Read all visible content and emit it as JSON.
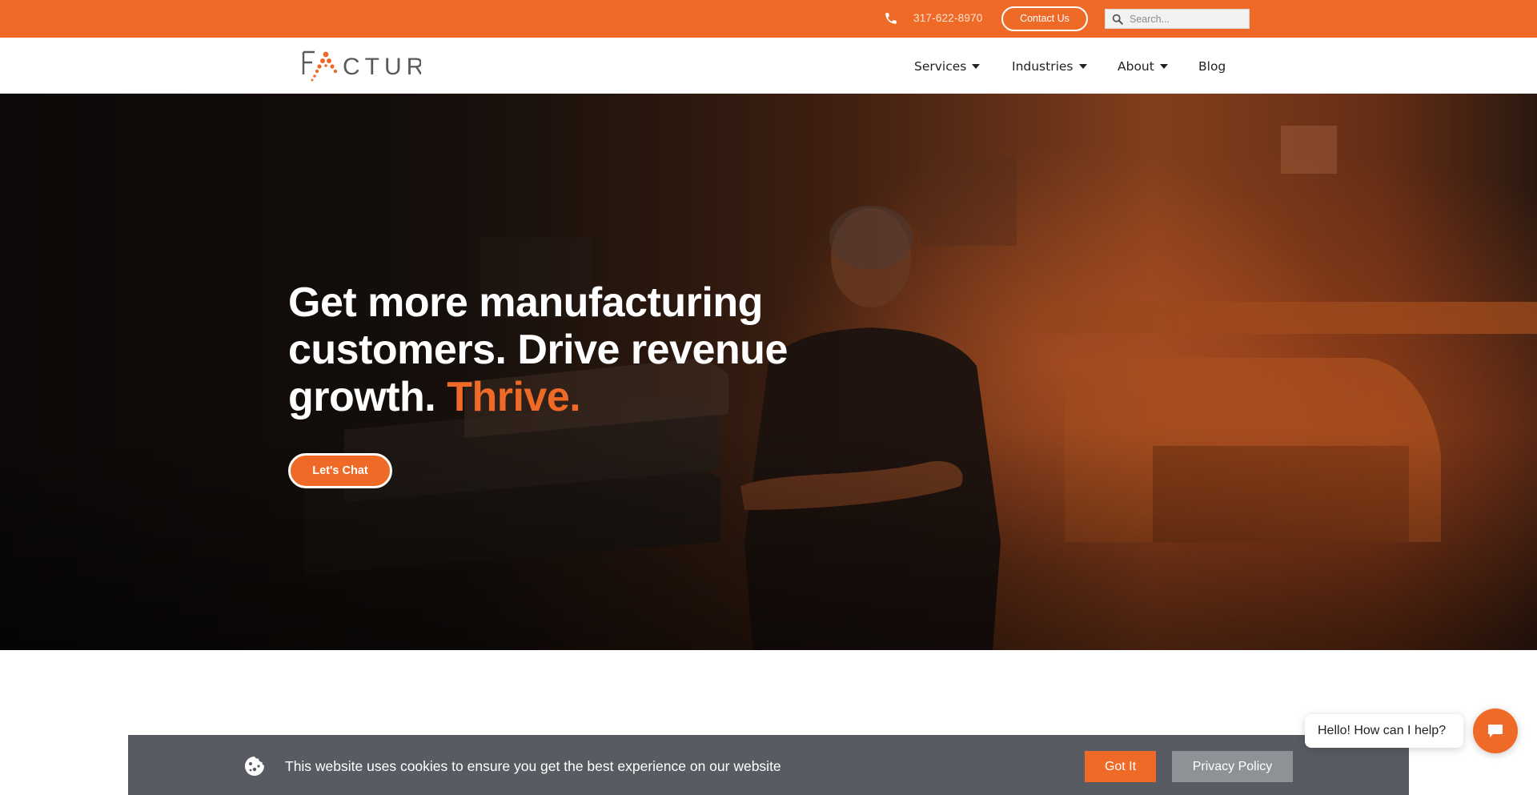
{
  "topbar": {
    "phone": "317-622-8970",
    "contact_label": "Contact Us",
    "search_placeholder": "Search...",
    "background_color": "#ee6a26"
  },
  "header": {
    "logo_text": "FACTUR",
    "nav": [
      {
        "label": "Services",
        "has_dropdown": true
      },
      {
        "label": "Industries",
        "has_dropdown": true
      },
      {
        "label": "About",
        "has_dropdown": true
      },
      {
        "label": "Blog",
        "has_dropdown": false
      }
    ]
  },
  "hero": {
    "title_main": "Get more manufacturing customers. Drive revenue growth.",
    "title_accent": "Thrive.",
    "cta_label": "Let's Chat",
    "accent_color": "#ee6a26"
  },
  "cookie_banner": {
    "message": "This website uses cookies to ensure you get the best experience on our website",
    "accept_label": "Got It",
    "policy_label": "Privacy Policy",
    "icon": "cookie-icon"
  },
  "chat_widget": {
    "greeting": "Hello! How can I help?",
    "icon": "chat-icon"
  }
}
